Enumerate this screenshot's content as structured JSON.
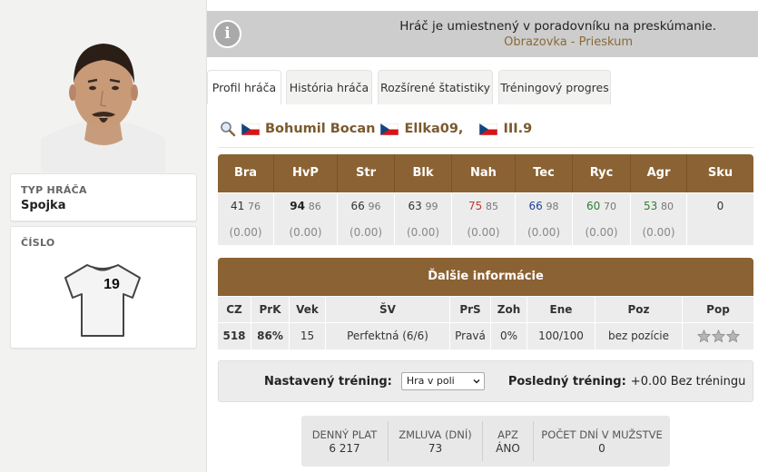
{
  "left": {
    "type_label": "TYP HRÁČA",
    "type_value": "Spojka",
    "number_label": "ČÍSLO",
    "jersey_number": "19"
  },
  "info": {
    "message": "Hráč je umiestnený v poradovníku na preskúmanie.",
    "link": "Obrazovka - Prieskum",
    "icon": "info-icon"
  },
  "tabs": [
    {
      "label": "Profil hráča",
      "active": true
    },
    {
      "label": "História hráča",
      "active": false
    },
    {
      "label": "Rozšírené štatistiky",
      "active": false
    },
    {
      "label": "Tréningový progres",
      "active": false
    }
  ],
  "player": {
    "name": "Bohumil Bocan",
    "team": "Ellka09,",
    "league": "III.9"
  },
  "skills": {
    "headers": [
      "Bra",
      "HvP",
      "Str",
      "Blk",
      "Nah",
      "Tec",
      "Ryc",
      "Agr",
      "Sku"
    ],
    "current": [
      "41",
      "94",
      "66",
      "63",
      "75",
      "66",
      "60",
      "53",
      "0"
    ],
    "max": [
      "76",
      "86",
      "96",
      "99",
      "85",
      "98",
      "70",
      "80",
      ""
    ],
    "changes": [
      "(0.00)",
      "(0.00)",
      "(0.00)",
      "(0.00)",
      "(0.00)",
      "(0.00)",
      "(0.00)",
      "(0.00)",
      ""
    ]
  },
  "more_info": {
    "title": "Ďalšie informácie",
    "headers": [
      "CZ",
      "PrK",
      "Vek",
      "ŠV",
      "PrS",
      "Zoh",
      "Ene",
      "Poz",
      "Pop"
    ],
    "values": [
      "518",
      "86%",
      "15",
      "Perfektná (6/6)",
      "Pravá",
      "0%",
      "100/100",
      "bez pozície",
      ""
    ],
    "popularity_stars": 3
  },
  "training": {
    "set_label": "Nastavený tréning:",
    "set_value": "Hra v poli",
    "last_label": "Posledný tréning:",
    "last_value": "+0.00 Bez tréningu"
  },
  "contract": [
    {
      "label": "DENNÝ PLAT",
      "value": "6 217"
    },
    {
      "label": "ZMLUVA (DNÍ)",
      "value": "73"
    },
    {
      "label": "APZ",
      "value": "ÁNO"
    },
    {
      "label": "POČET DNÍ V MUŽSTVE",
      "value": "0"
    }
  ]
}
